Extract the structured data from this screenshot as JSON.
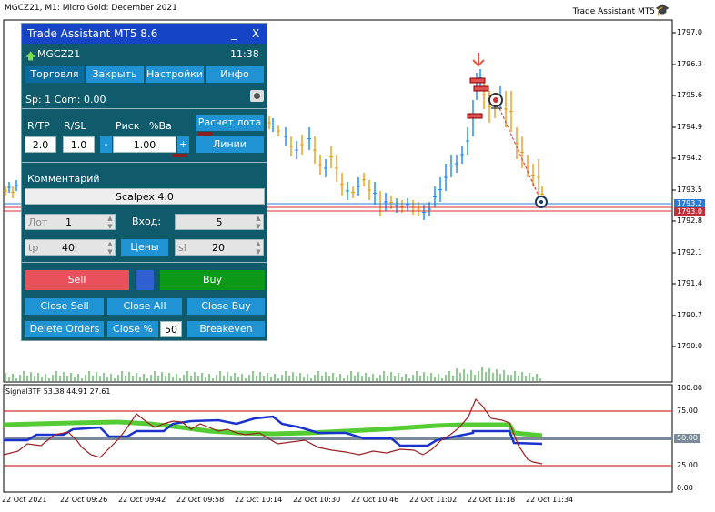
{
  "chart_header": {
    "symbol_line": "MGCZ21, M1:  Micro Gold: December 2021",
    "ea_name": "Trade Assistant MT5"
  },
  "price_axis": [
    "1797.0",
    "1796.3",
    "1795.6",
    "1794.9",
    "1794.2",
    "1793.5",
    "1792.8",
    "1792.1",
    "1791.4",
    "1790.7",
    "1790.0"
  ],
  "price_tags": {
    "upper": "1793.2",
    "lower": "1793.0"
  },
  "indicator": {
    "name_line": "Signal3TF 53.38 44.91 27.61",
    "axis": [
      "100.00",
      "75.00",
      "50.00",
      "25.00",
      "0.00"
    ],
    "level_tag": "50.00"
  },
  "time_axis": [
    "22 Oct 2021",
    "22 Oct 09:26",
    "22 Oct 09:42",
    "22 Oct 09:58",
    "22 Oct 10:14",
    "22 Oct 10:30",
    "22 Oct 10:46",
    "22 Oct 11:02",
    "22 Oct 11:18",
    "22 Oct 11:34"
  ],
  "colors": {
    "bull": "#1e90ff",
    "bear": "#f0a020",
    "panel": "#0f5a6b",
    "title_bar": "#1545c6",
    "sell": "#e8505b",
    "buy": "#0a9a17"
  },
  "panel": {
    "title": "Trade Assistant MT5 8.6",
    "minimize": "_",
    "close": "X",
    "symbol": "MGCZ21",
    "time": "11:38",
    "tabs": [
      "Торговля",
      "Закрыть",
      "Настройки",
      "Инфо"
    ],
    "spread_line": "Sp: 1   Com: 0.00",
    "rtp_label": "R/TP",
    "rsl_label": "R/SL",
    "risk_label": "Риск",
    "pct_label": "%Ba",
    "calc_lot": "Расчет лота",
    "rtp_value": "2.0",
    "rsl_value": "1.0",
    "minus": "-",
    "risk_value": "1.00",
    "plus": "+",
    "lines_btn": "Линии",
    "comment_label": "Комментарий",
    "comment_value": "Scalpex 4.0",
    "lot_label": "Лот",
    "lot_value": "1",
    "entries_label": "Вход:",
    "entries_value": "5",
    "tp_label": "tp",
    "tp_value": "40",
    "prices_btn": "Цены",
    "sl_label": "sl",
    "sl_value": "20",
    "sell": "Sell",
    "buy": "Buy",
    "close_sell": "Close Sell",
    "close_all": "Close All",
    "close_buy": "Close Buy",
    "delete_orders": "Delete Orders",
    "close_pct": "Close %",
    "close_pct_value": "50",
    "breakeven": "Breakeven"
  }
}
